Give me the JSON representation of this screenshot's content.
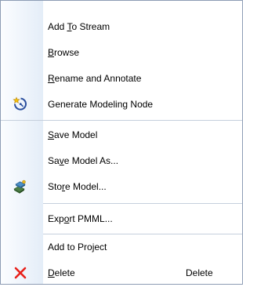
{
  "menu": {
    "items": [
      {
        "id": "add-to-stream",
        "before": "Add ",
        "mnemonic": "T",
        "after": "o Stream"
      },
      {
        "id": "browse",
        "before": "",
        "mnemonic": "B",
        "after": "rowse"
      },
      {
        "id": "rename-and-annotate",
        "before": "",
        "mnemonic": "R",
        "after": "ename and Annotate"
      },
      {
        "id": "generate-modeling-node",
        "before": "",
        "mnemonic": "",
        "after": "Generate Modeling Node",
        "icon": "generate-node-icon"
      },
      {
        "id": "save-model",
        "before": "",
        "mnemonic": "S",
        "after": "ave Model"
      },
      {
        "id": "save-model-as",
        "before": "Sa",
        "mnemonic": "v",
        "after": "e Model As..."
      },
      {
        "id": "store-model",
        "before": "Sto",
        "mnemonic": "r",
        "after": "e Model...",
        "icon": "store-model-icon"
      },
      {
        "id": "export-pmml",
        "before": "Exp",
        "mnemonic": "o",
        "after": "rt PMML..."
      },
      {
        "id": "add-to-project",
        "before": "",
        "mnemonic": "",
        "after": "Add to Project"
      },
      {
        "id": "delete",
        "before": "",
        "mnemonic": "D",
        "after": "elete",
        "icon": "delete-x-icon",
        "shortcut": "Delete"
      }
    ]
  },
  "colors": {
    "border": "#8c9cb4",
    "separator": "#c5cfdc",
    "gutter_start": "#fbfdff",
    "gutter_end": "#e4edf8",
    "delete_icon": "#e8201a"
  }
}
